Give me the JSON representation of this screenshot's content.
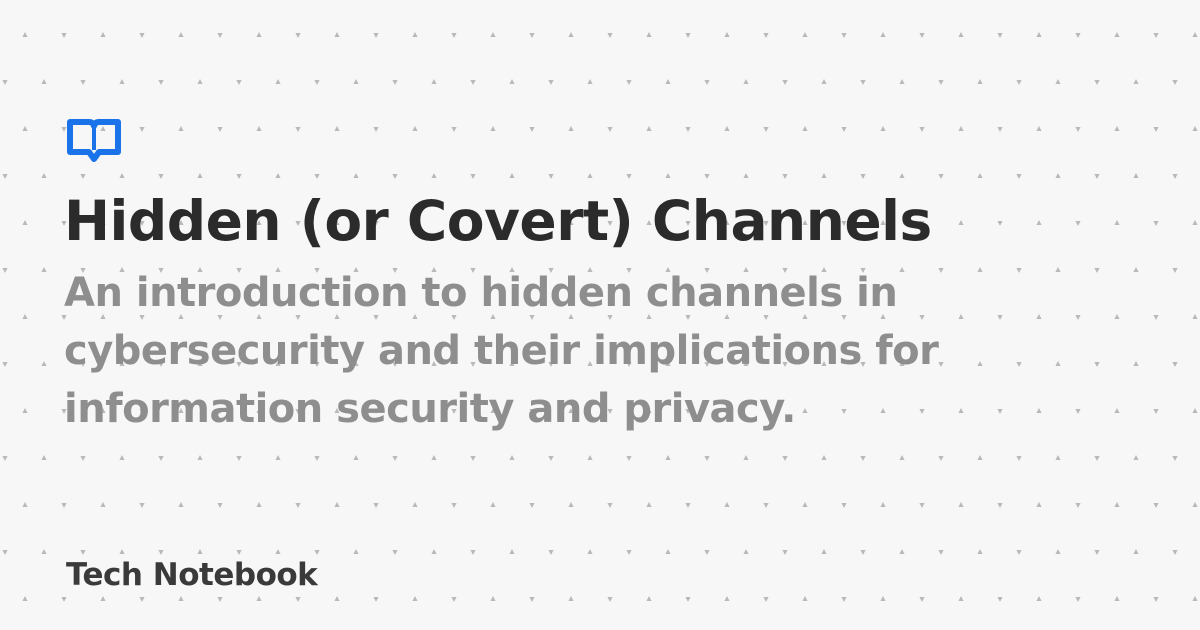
{
  "logo": {
    "icon": "book-icon",
    "color": "#1a73e8"
  },
  "post": {
    "title": "Hidden (or Covert) Channels",
    "subtitle": "An introduction to hidden channels in cybersecurity and their implications for information security and privacy."
  },
  "site": {
    "name": "Tech Notebook"
  },
  "colors": {
    "background": "#f7f7f7",
    "pattern": "#b4b4b4",
    "title": "#2b2b2b",
    "subtitle": "#8e8e8e",
    "brand": "#3a3a3a"
  }
}
